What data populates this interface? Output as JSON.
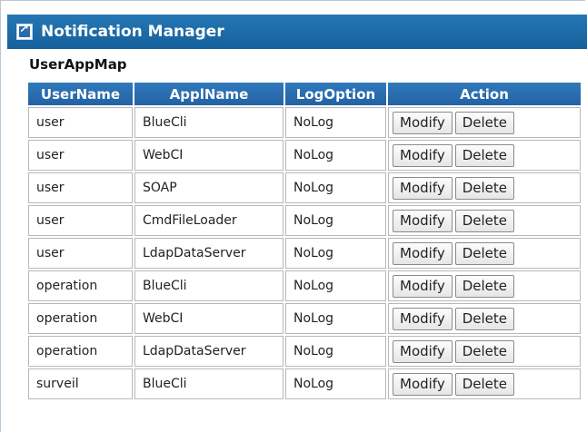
{
  "window": {
    "title": "Notification Manager"
  },
  "section": {
    "label": "UserAppMap"
  },
  "table": {
    "headers": [
      "UserName",
      "ApplName",
      "LogOption",
      "Action"
    ],
    "rows": [
      {
        "user": "user",
        "app": "BlueCli",
        "log": "NoLog"
      },
      {
        "user": "user",
        "app": "WebCI",
        "log": "NoLog"
      },
      {
        "user": "user",
        "app": "SOAP",
        "log": "NoLog"
      },
      {
        "user": "user",
        "app": "CmdFileLoader",
        "log": "NoLog"
      },
      {
        "user": "user",
        "app": "LdapDataServer",
        "log": "NoLog"
      },
      {
        "user": "operation",
        "app": "BlueCli",
        "log": "NoLog"
      },
      {
        "user": "operation",
        "app": "WebCI",
        "log": "NoLog"
      },
      {
        "user": "operation",
        "app": "LdapDataServer",
        "log": "NoLog"
      },
      {
        "user": "surveil",
        "app": "BlueCli",
        "log": "NoLog"
      }
    ],
    "modify_label": "Modify",
    "delete_label": "Delete"
  },
  "colors": {
    "title_bar": "#1a6aa8",
    "header_bg": "#2b6cb0"
  },
  "icons": {
    "title": "window-link-icon"
  }
}
